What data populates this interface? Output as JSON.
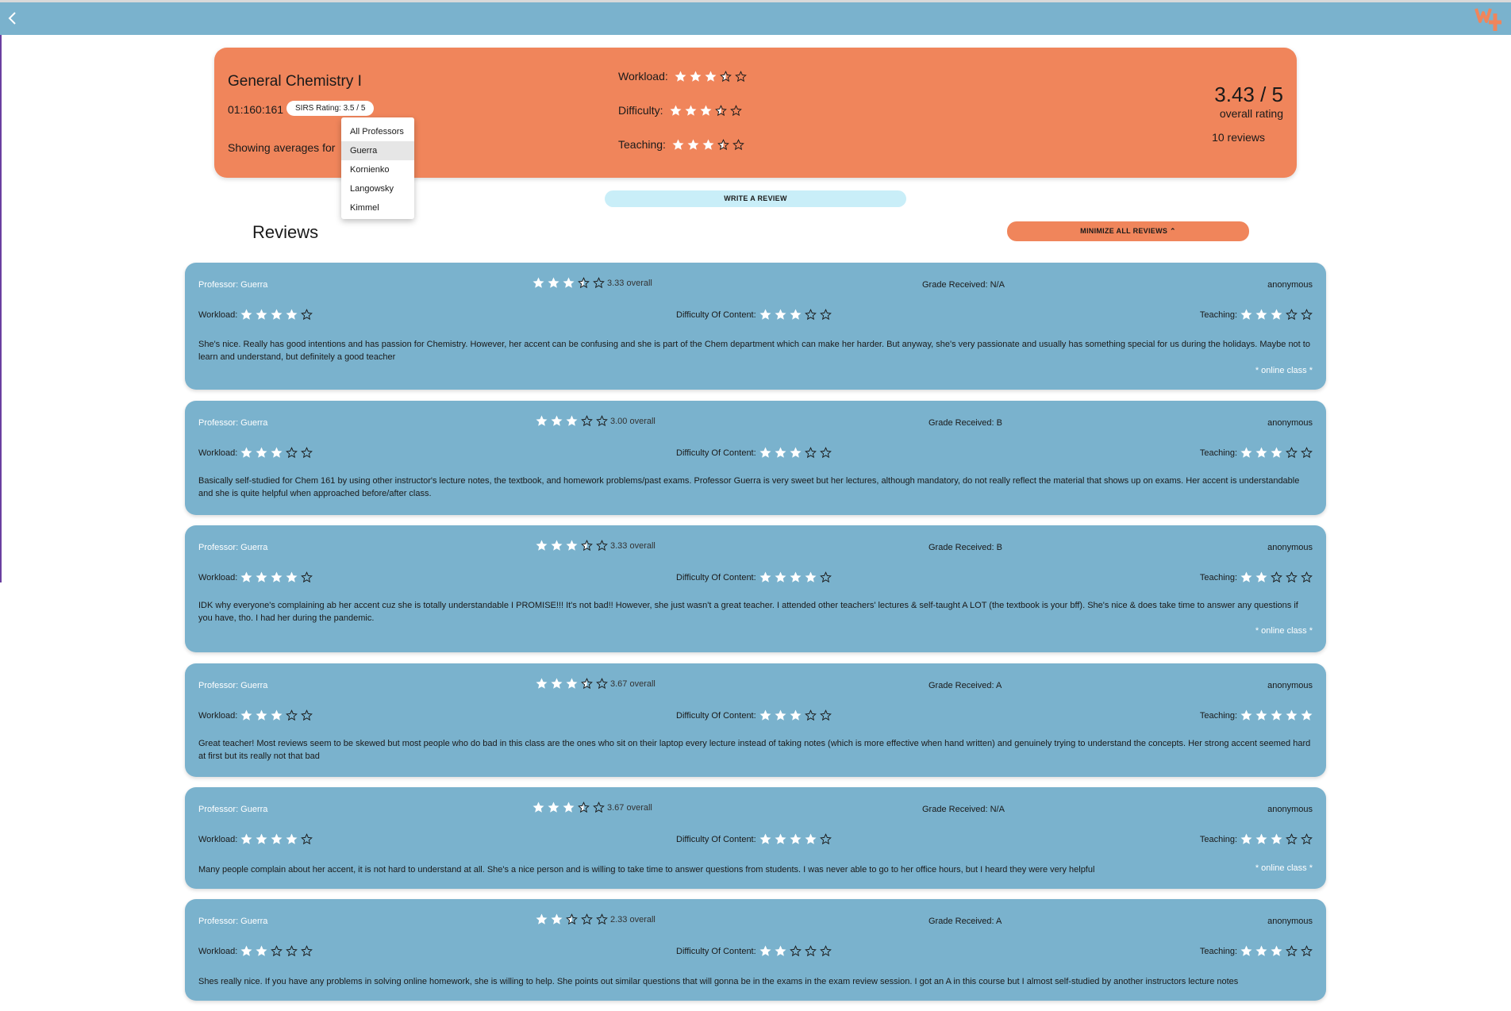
{
  "course": {
    "title": "General Chemistry I",
    "code": "01:160:161",
    "sirs_rating": "SIRS Rating: 3.5 / 5",
    "showing_label": "Showing averages for",
    "workload_label": "Workload:",
    "difficulty_label": "Difficulty:",
    "teaching_label": "Teaching:",
    "workload_stars": 3.5,
    "difficulty_stars": 3.5,
    "teaching_stars": 3.5,
    "overall_value": "3.43 / 5",
    "overall_label": "overall rating",
    "review_count": "10 reviews"
  },
  "dropdown": {
    "options": [
      "All Professors",
      "Guerra",
      "Kornienko",
      "Langowsky",
      "Kimmel"
    ],
    "selected_index": 1
  },
  "actions": {
    "write_review": "WRITE A REVIEW",
    "minimize_all": "MINIMIZE ALL REVIEWS ⌃"
  },
  "reviews_heading": "Reviews",
  "review_labels": {
    "workload": "Workload:",
    "difficulty": "Difficulty Of Content:",
    "teaching": "Teaching:",
    "online": "* online class *"
  },
  "reviews": [
    {
      "professor": "Professor: Guerra",
      "overall_stars": 3.5,
      "overall_text": "3.33 overall",
      "grade": "Grade Received: N/A",
      "author": "anonymous",
      "workload": 4,
      "difficulty": 3,
      "teaching": 3,
      "body": "She's nice. Really has good intentions and has passion for Chemistry. However, her accent can be confusing and she is part of the Chem department which can make her harder. But anyway, she's very passionate and usually has something special for us during the holidays. Maybe not to learn and understand, but definitely a good teacher",
      "online": true
    },
    {
      "professor": "Professor: Guerra",
      "overall_stars": 3,
      "overall_text": "3.00 overall",
      "grade": "Grade Received: B",
      "author": "anonymous",
      "workload": 3,
      "difficulty": 3,
      "teaching": 3,
      "body": "Basically self-studied for Chem 161 by using other instructor's lecture notes, the textbook, and homework problems/past exams. Professor Guerra is very sweet but her lectures, although mandatory, do not really reflect the material that shows up on exams. Her accent is understandable and she is quite helpful when approached before/after class.",
      "online": false
    },
    {
      "professor": "Professor: Guerra",
      "overall_stars": 3.5,
      "overall_text": "3.33 overall",
      "grade": "Grade Received: B",
      "author": "anonymous",
      "workload": 4,
      "difficulty": 4,
      "teaching": 2,
      "body": "IDK why everyone's complaining ab her accent cuz she is totally understandable I PROMISE!!! It's not bad!! However, she just wasn't a great teacher. I attended other teachers' lectures & self-taught A LOT (the textbook is your bff). She's nice & does take time to answer any questions if you have, tho. I had her during the pandemic.",
      "online": true
    },
    {
      "professor": "Professor: Guerra",
      "overall_stars": 3.5,
      "overall_text": "3.67 overall",
      "grade": "Grade Received: A",
      "author": "anonymous",
      "workload": 3,
      "difficulty": 3,
      "teaching": 5,
      "body": "Great teacher! Most reviews seem to be skewed but most people who do bad in this class are the ones who sit on their laptop every lecture instead of taking notes (which is more effective when hand written) and genuinely trying to understand the concepts. Her strong accent seemed hard at first but its really not that bad",
      "online": false
    },
    {
      "professor": "Professor: Guerra",
      "overall_stars": 3.5,
      "overall_text": "3.67 overall",
      "grade": "Grade Received: N/A",
      "author": "anonymous",
      "workload": 4,
      "difficulty": 4,
      "teaching": 3,
      "body": "Many people complain about her accent, it is not hard to understand at all. She's a nice person and is willing to take time to answer questions from students. I was never able to go to her office hours, but I heard they were very helpful",
      "online": true
    },
    {
      "professor": "Professor: Guerra",
      "overall_stars": 2.5,
      "overall_text": "2.33 overall",
      "grade": "Grade Received: A",
      "author": "anonymous",
      "workload": 2,
      "difficulty": 2,
      "teaching": 3,
      "body": "Shes really nice. If you have any problems in solving online homework, she is willing to help. She points out similar questions that will gonna be in the exams in the exam review session. I got an A in this course but I almost self-studied by another instructors lecture notes",
      "online": false
    }
  ]
}
